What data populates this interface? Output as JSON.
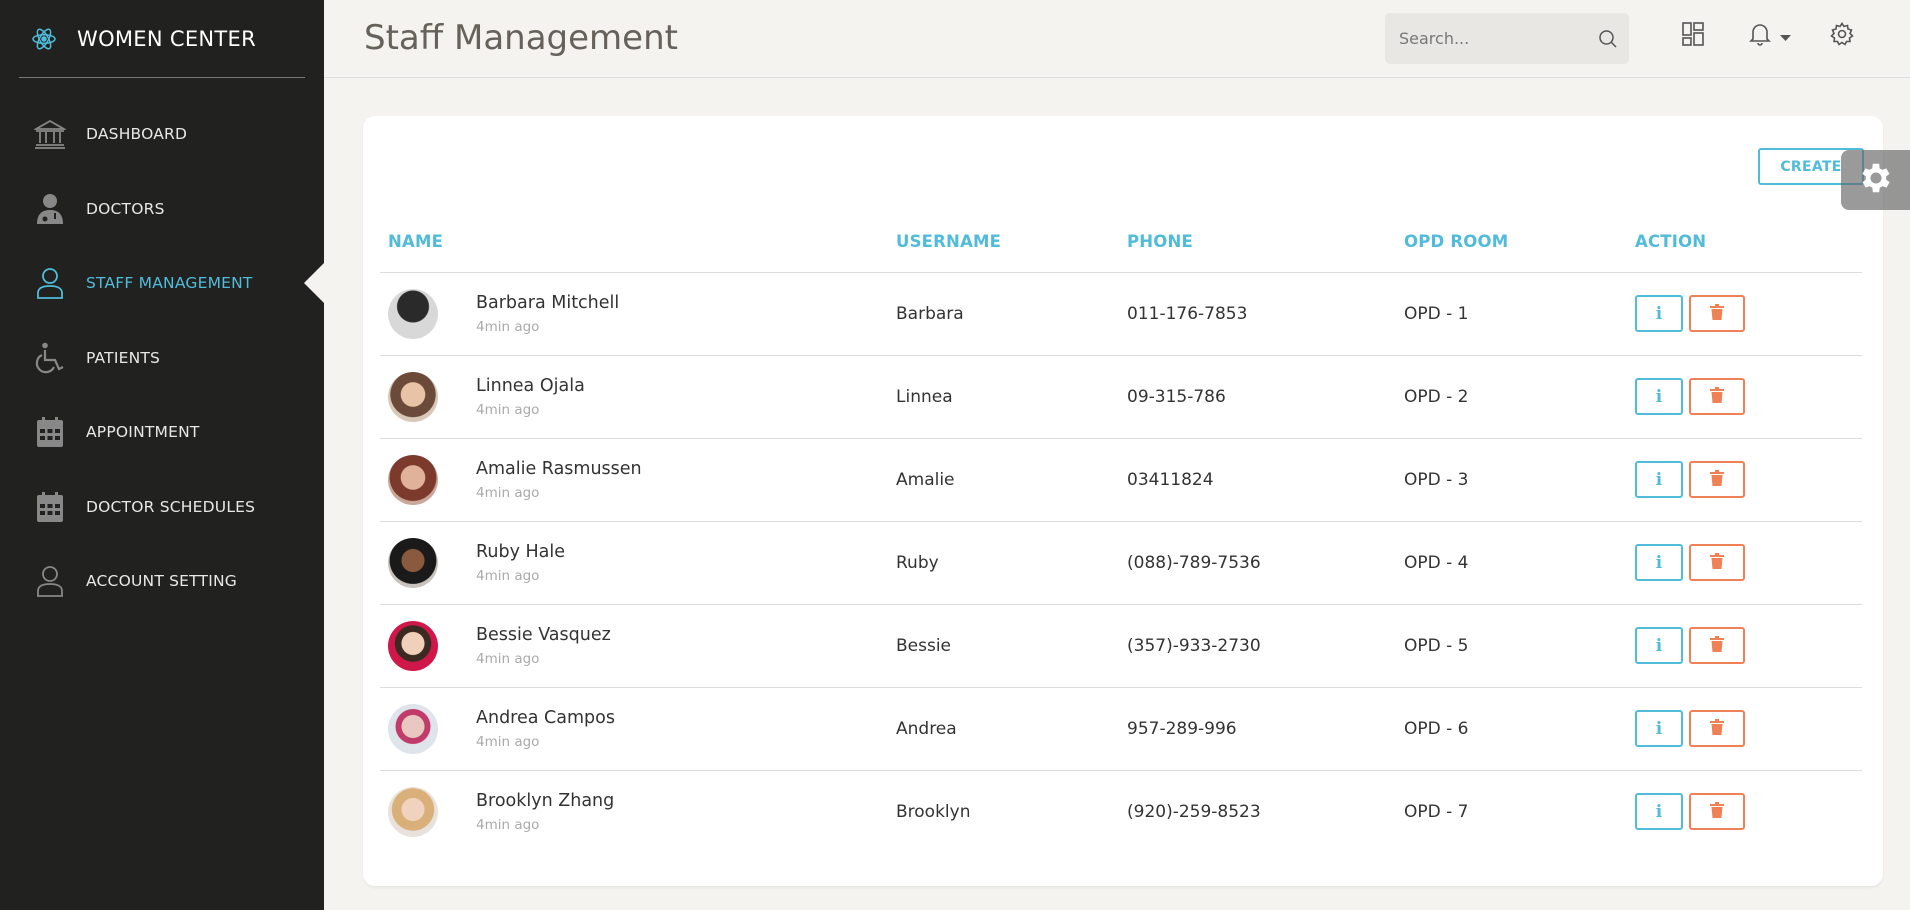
{
  "app": {
    "name": "WOMEN CENTER"
  },
  "sidebar": {
    "items": [
      {
        "label": "DASHBOARD",
        "icon": "bank-icon"
      },
      {
        "label": "DOCTORS",
        "icon": "doctor-icon"
      },
      {
        "label": "STAFF MANAGEMENT",
        "icon": "user-icon",
        "active": true
      },
      {
        "label": "PATIENTS",
        "icon": "wheelchair-icon"
      },
      {
        "label": "APPOINTMENT",
        "icon": "calendar-icon"
      },
      {
        "label": "DOCTOR SCHEDULES",
        "icon": "calendar-icon"
      },
      {
        "label": "ACCOUNT SETTING",
        "icon": "user-icon"
      }
    ]
  },
  "header": {
    "title": "Staff Management",
    "search_placeholder": "Search..."
  },
  "main": {
    "create_label": "CREATE",
    "columns": [
      "NAME",
      "USERNAME",
      "PHONE",
      "OPD ROOM",
      "ACTION"
    ],
    "info_label": "i",
    "rows": [
      {
        "name": "Barbara Mitchell",
        "time": "4min ago",
        "username": "Barbara",
        "phone": "011-176-7853",
        "room": "OPD - 1"
      },
      {
        "name": "Linnea Ojala",
        "time": "4min ago",
        "username": "Linnea",
        "phone": "09-315-786",
        "room": "OPD - 2"
      },
      {
        "name": "Amalie Rasmussen",
        "time": "4min ago",
        "username": "Amalie",
        "phone": "03411824",
        "room": "OPD - 3"
      },
      {
        "name": "Ruby Hale",
        "time": "4min ago",
        "username": "Ruby",
        "phone": "(088)-789-7536",
        "room": "OPD - 4"
      },
      {
        "name": "Bessie Vasquez",
        "time": "4min ago",
        "username": "Bessie",
        "phone": "(357)-933-2730",
        "room": "OPD - 5"
      },
      {
        "name": "Andrea Campos",
        "time": "4min ago",
        "username": "Andrea",
        "phone": "957-289-996",
        "room": "OPD - 6"
      },
      {
        "name": "Brooklyn Zhang",
        "time": "4min ago",
        "username": "Brooklyn",
        "phone": "(920)-259-8523",
        "room": "OPD - 7"
      }
    ]
  },
  "colors": {
    "sidebar_bg": "#212120",
    "accent": "#51bcda",
    "danger": "#ef8157",
    "page_bg": "#f4f3ef"
  }
}
